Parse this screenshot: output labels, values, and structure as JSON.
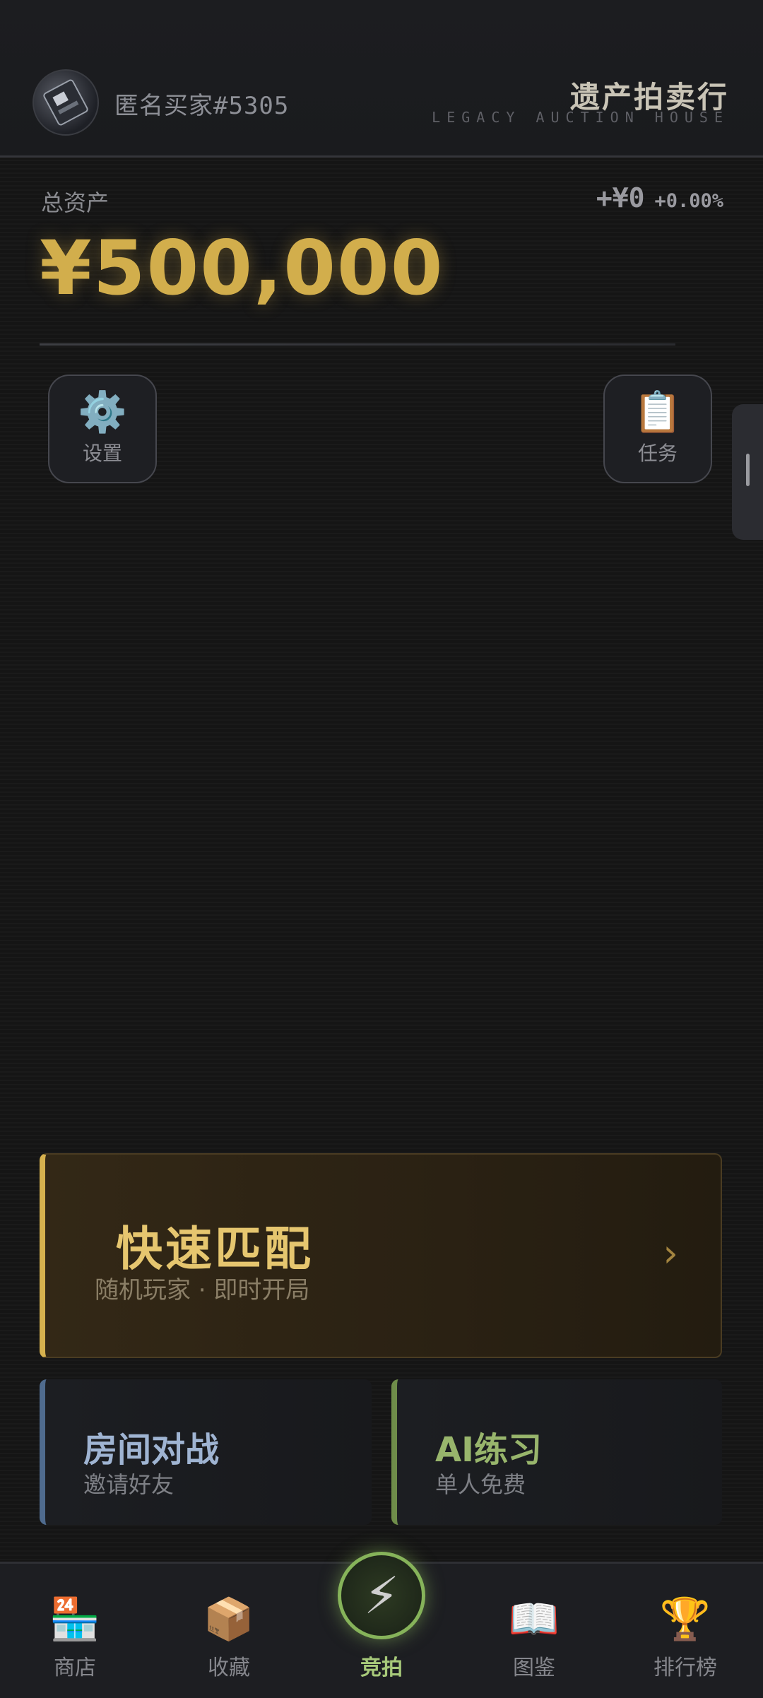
{
  "header": {
    "username": "匿名买家#5305",
    "brand_title": "遗产拍卖行",
    "brand_subtitle": "LEGACY AUCTION HOUSE"
  },
  "assets": {
    "label": "总资产",
    "value": "¥500,000",
    "delta_amount": "+¥0",
    "delta_percent": "+0.00%"
  },
  "quick_buttons": {
    "settings": {
      "icon": "⚙️",
      "label": "设置"
    },
    "tasks": {
      "icon": "📋",
      "label": "任务"
    }
  },
  "modes": {
    "quick_match": {
      "title": "快速匹配",
      "subtitle": "随机玩家 · 即时开局",
      "chevron": "›"
    },
    "room_battle": {
      "title": "房间对战",
      "subtitle": "邀请好友"
    },
    "ai_practice": {
      "title": "AI练习",
      "subtitle": "单人免费"
    }
  },
  "nav": {
    "items": [
      {
        "icon": "🏪",
        "label": "商店"
      },
      {
        "icon": "📦",
        "label": "收藏"
      },
      {
        "icon": "⚡",
        "label": "竞拍"
      },
      {
        "icon": "📖",
        "label": "图鉴"
      },
      {
        "icon": "🏆",
        "label": "排行榜"
      }
    ]
  },
  "colors": {
    "gold": "#d2ae4c",
    "quick_match_accent": "#d6b14e",
    "room_accent": "#4f6b8e",
    "ai_accent": "#6f8d4a",
    "active_nav": "#a7c97a"
  }
}
